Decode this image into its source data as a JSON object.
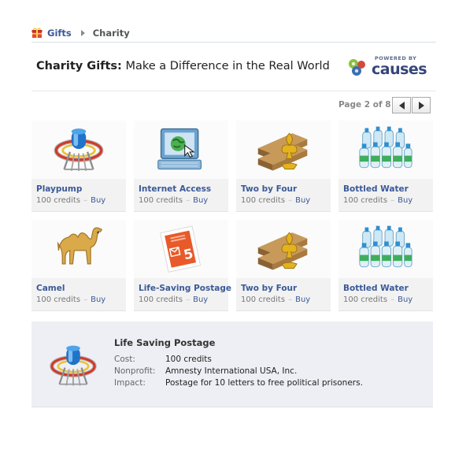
{
  "breadcrumb": {
    "root": "Gifts",
    "current": "Charity",
    "root_icon": "gift-box-icon"
  },
  "header": {
    "title_bold": "Charity Gifts:",
    "title_rest": "Make a Difference in the Real World"
  },
  "brand": {
    "powered_by": "POWERED BY",
    "name": "causes",
    "icon": "causes-logo-icon"
  },
  "pager": {
    "label": "Page 2 of 8",
    "prev_icon": "arrow-left-icon",
    "next_icon": "arrow-right-icon"
  },
  "gifts": [
    {
      "name": "Playpump",
      "credits": "100 credits",
      "sep": "–",
      "buy": "Buy",
      "icon": "playpump-icon"
    },
    {
      "name": "Internet Access",
      "credits": "100 credits",
      "sep": "–",
      "buy": "Buy",
      "icon": "computer-globe-icon"
    },
    {
      "name": "Two by Four",
      "credits": "100 credits",
      "sep": "–",
      "buy": "Buy",
      "icon": "lumber-fleur-de-lis-icon"
    },
    {
      "name": "Bottled Water",
      "credits": "100 credits",
      "sep": "–",
      "buy": "Buy",
      "icon": "water-bottles-icon"
    },
    {
      "name": "Camel",
      "credits": "100 credits",
      "sep": "–",
      "buy": "Buy",
      "icon": "camel-icon"
    },
    {
      "name": "Life-Saving Postage",
      "credits": "100 credits",
      "sep": "–",
      "buy": "Buy",
      "icon": "postage-stamp-icon"
    },
    {
      "name": "Two by Four",
      "credits": "100 credits",
      "sep": "–",
      "buy": "Buy",
      "icon": "lumber-fleur-de-lis-icon"
    },
    {
      "name": "Bottled Water",
      "credits": "100 credits",
      "sep": "–",
      "buy": "Buy",
      "icon": "water-bottles-icon"
    }
  ],
  "detail": {
    "title": "Life Saving Postage",
    "icon": "playpump-icon",
    "rows": [
      {
        "label": "Cost:",
        "value": "100 credits"
      },
      {
        "label": "Nonprofit:",
        "value": "Amnesty International USA, Inc."
      },
      {
        "label": "Impact:",
        "value": "Postage for 10 letters to free political prisoners."
      }
    ]
  },
  "colors": {
    "link": "#3b5998",
    "tile_bg": "#f2f2f2",
    "detail_bg": "#edeff4",
    "brand": "#36457a"
  }
}
